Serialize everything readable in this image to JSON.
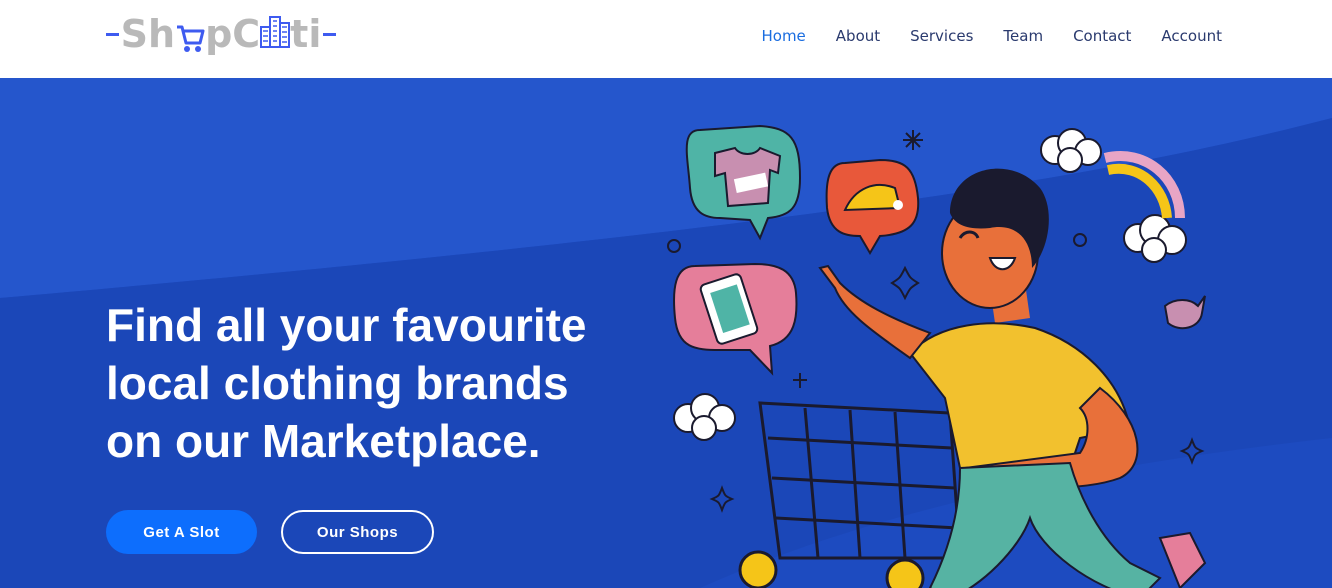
{
  "brand": {
    "name_part1": "Sh",
    "name_part2": "pC",
    "name_part3": "ti",
    "accent_color": "#3e5bf0",
    "text_color": "#b9b9b9"
  },
  "nav": {
    "items": [
      {
        "label": "Home",
        "active": true
      },
      {
        "label": "About",
        "active": false
      },
      {
        "label": "Services",
        "active": false
      },
      {
        "label": "Team",
        "active": false
      },
      {
        "label": "Contact",
        "active": false
      },
      {
        "label": "Account",
        "active": false
      }
    ],
    "active_color": "#1a6de0",
    "color": "#2a3a6e"
  },
  "hero": {
    "headline_line1": "Find all your favourite",
    "headline_line2": "local clothing brands",
    "headline_line3": "on our Marketplace.",
    "primary_button": "Get A Slot",
    "secondary_button": "Our Shops",
    "background_color": "#1f4fc4",
    "illustration": "shopper-with-cart-illustration"
  }
}
